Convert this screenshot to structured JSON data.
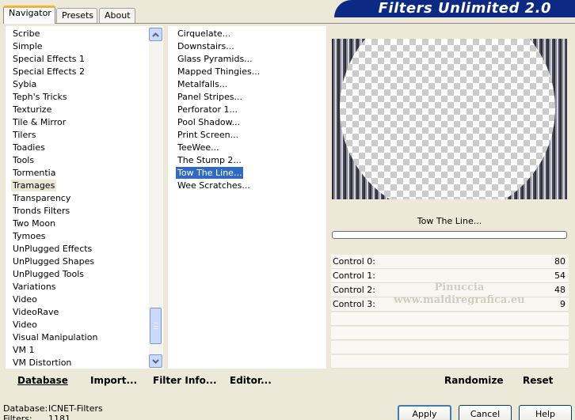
{
  "window": {
    "title": "Filters Unlimited 2.0"
  },
  "tabs": [
    {
      "label": "Navigator",
      "active": true
    },
    {
      "label": "Presets",
      "active": false
    },
    {
      "label": "About",
      "active": false
    }
  ],
  "categories": {
    "items": [
      "Scribe",
      "Simple",
      "Special Effects 1",
      "Special Effects 2",
      "Sybia",
      "Teph's Tricks",
      "Texturize",
      "Tile & Mirror",
      "Tilers",
      "Toadies",
      "Tools",
      "Tormentia",
      "Tramages",
      "Transparency",
      "Tronds Filters",
      "Two Moon",
      "Tymoes",
      "UnPlugged Effects",
      "UnPlugged Shapes",
      "UnPlugged Tools",
      "Variations",
      "Video",
      "VideoRave",
      "Video",
      "Visual Manipulation",
      "VM 1",
      "VM Distortion"
    ],
    "selected": "Tramages"
  },
  "filters": {
    "items": [
      "Cirquelate...",
      "Downstairs...",
      "Glass Pyramids...",
      "Mapped Thingies...",
      "Metalfalls...",
      "Panel Stripes...",
      "Perforator 1...",
      "Pool Shadow...",
      "Print Screen...",
      "TeeWee...",
      "The Stump 2...",
      "Tow The Line...",
      "Wee Scratches..."
    ],
    "selected": "Tow The Line..."
  },
  "preview": {
    "filter_name": "Tow The Line..."
  },
  "controls": [
    {
      "label": "Control 0:",
      "value": "80"
    },
    {
      "label": "Control 1:",
      "value": "54"
    },
    {
      "label": "Control 2:",
      "value": "48"
    },
    {
      "label": "Control 3:",
      "value": "9"
    }
  ],
  "watermark": {
    "line1": "Pinuccia",
    "line2": "www.maldiregrafica.eu"
  },
  "actions": {
    "database": "Database",
    "import": "Import...",
    "filter_info": "Filter Info...",
    "editor": "Editor...",
    "randomize": "Randomize",
    "reset": "Reset"
  },
  "status": {
    "database_label": "Database:",
    "database_value": "ICNET-Filters",
    "filters_label": "Filters:",
    "filters_value": "1181"
  },
  "buttons": {
    "apply": "Apply",
    "cancel": "Cancel",
    "help": "Help"
  },
  "colors": {
    "banner": "#0c2a84",
    "selection": "#316ac5",
    "dialog_bg": "#ece9d8"
  }
}
